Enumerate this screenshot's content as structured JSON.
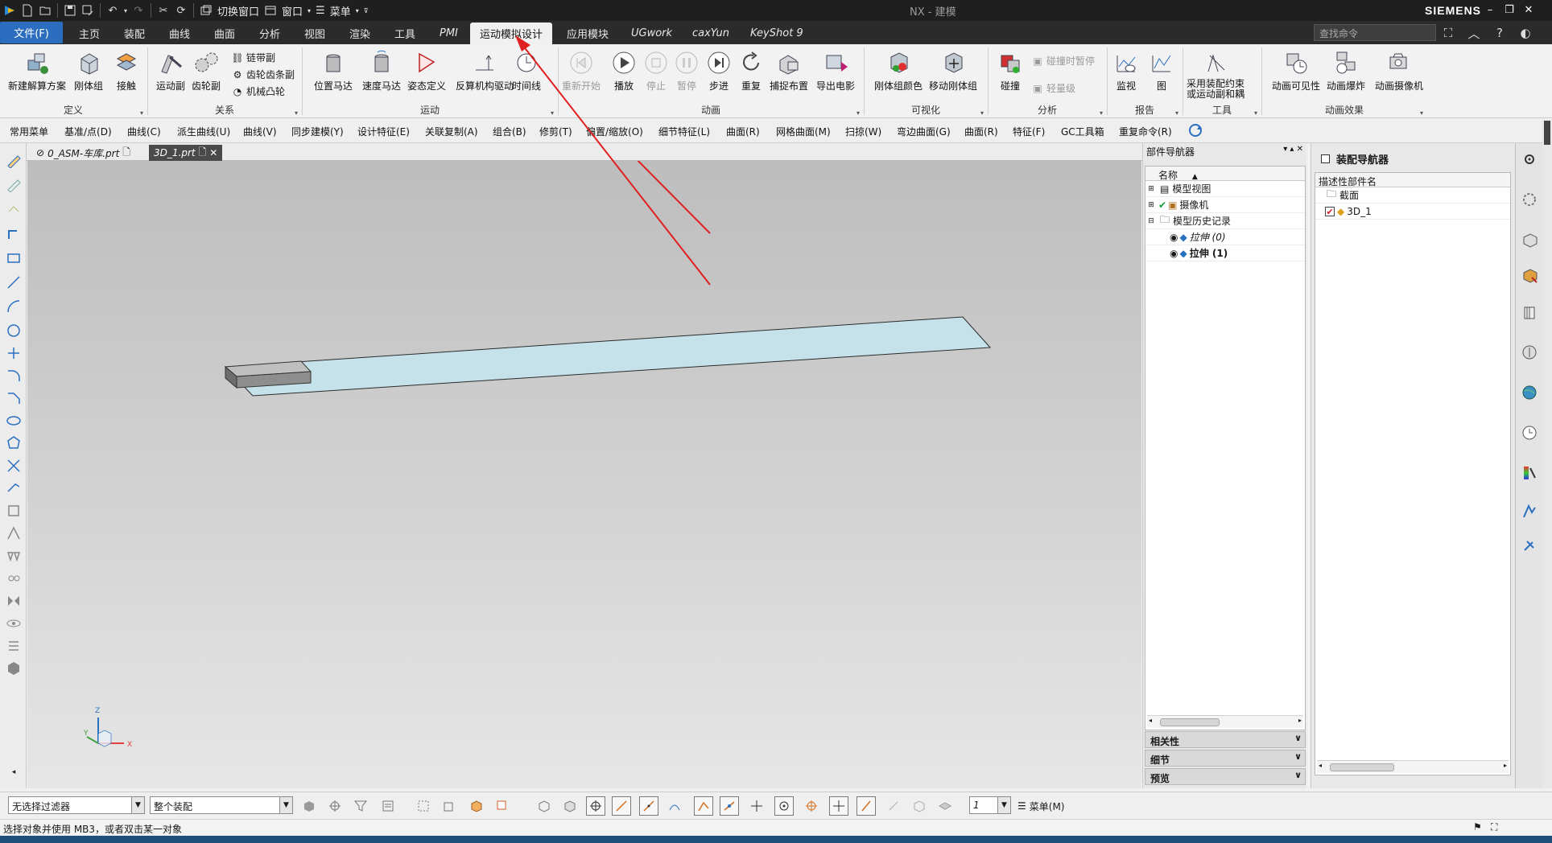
{
  "titlebar": {
    "switch_window": "切换窗口",
    "window": "窗口",
    "menu": "菜单",
    "title": "NX - 建模",
    "brand": "SIEMENS"
  },
  "menubar": {
    "file": "文件(F)",
    "tabs": [
      "主页",
      "装配",
      "曲线",
      "曲面",
      "分析",
      "视图",
      "渲染",
      "工具",
      "PMI",
      "运动模拟设计",
      "应用模块",
      "UGwork",
      "caxYun",
      "KeyShot 9"
    ],
    "search_placeholder": "查找命令"
  },
  "ribbon": {
    "groups": [
      "定义",
      "关系",
      "运动",
      "动画",
      "可视化",
      "分析",
      "报告",
      "工具",
      "动画效果"
    ],
    "def": [
      "新建解算方案",
      "刚体组",
      "接触"
    ],
    "rel": [
      "运动副",
      "齿轮副"
    ],
    "rel_small": [
      "链带副",
      "齿轮齿条副",
      "机械凸轮"
    ],
    "motion": [
      "位置马达",
      "速度马达",
      "姿态定义",
      "反算机构驱动",
      "时间线"
    ],
    "anim": [
      "重新开始",
      "播放",
      "停止",
      "暂停",
      "步进",
      "重复",
      "捕捉布置",
      "导出电影"
    ],
    "vis": [
      "刚体组颜色",
      "移动刚体组"
    ],
    "ana": "碰撞",
    "ana_small": [
      "碰撞时暂停",
      "轻量级"
    ],
    "report": [
      "监视",
      "图"
    ],
    "tool_line1": "采用装配约束",
    "tool_line2": "或运动副和耦",
    "effects": [
      "动画可见性",
      "动画爆炸",
      "动画摄像机"
    ]
  },
  "cmdbar": [
    "常用菜单",
    "基准/点(D)",
    "曲线(C)",
    "派生曲线(U)",
    "曲线(V)",
    "同步建模(Y)",
    "设计特征(E)",
    "关联复制(A)",
    "组合(B)",
    "修剪(T)",
    "偏置/缩放(O)",
    "细节特征(L)",
    "曲面(R)",
    "网格曲面(M)",
    "扫掠(W)",
    "弯边曲面(G)",
    "曲面(R)",
    "特征(F)",
    "GC工具箱",
    "重复命令(R)"
  ],
  "doctabs": [
    {
      "label": "0_ASM-车库.prt"
    },
    {
      "label": "3D_1.prt"
    }
  ],
  "triad": {
    "x": "X",
    "y": "Y",
    "z": "Z"
  },
  "partnav": {
    "title": "部件导航器",
    "col": "名称",
    "items": [
      "模型视图",
      "摄像机",
      "模型历史记录",
      "拉伸 (0)",
      "拉伸 (1)"
    ],
    "sections": [
      "相关性",
      "细节",
      "预览"
    ]
  },
  "asmnav": {
    "title": "装配导航器",
    "col": "描述性部件名",
    "items": [
      "截面",
      "3D_1"
    ]
  },
  "bottom": {
    "filter": "无选择过滤器",
    "scope": "整个装配",
    "num": "1",
    "menu": "菜单(M)"
  },
  "status": "选择对象并使用 MB3，或者双击某一对象",
  "colors": {
    "accent": "#2b6ebf",
    "part_face": "#c5e2ea",
    "annotation_arrow": "#e02020"
  }
}
